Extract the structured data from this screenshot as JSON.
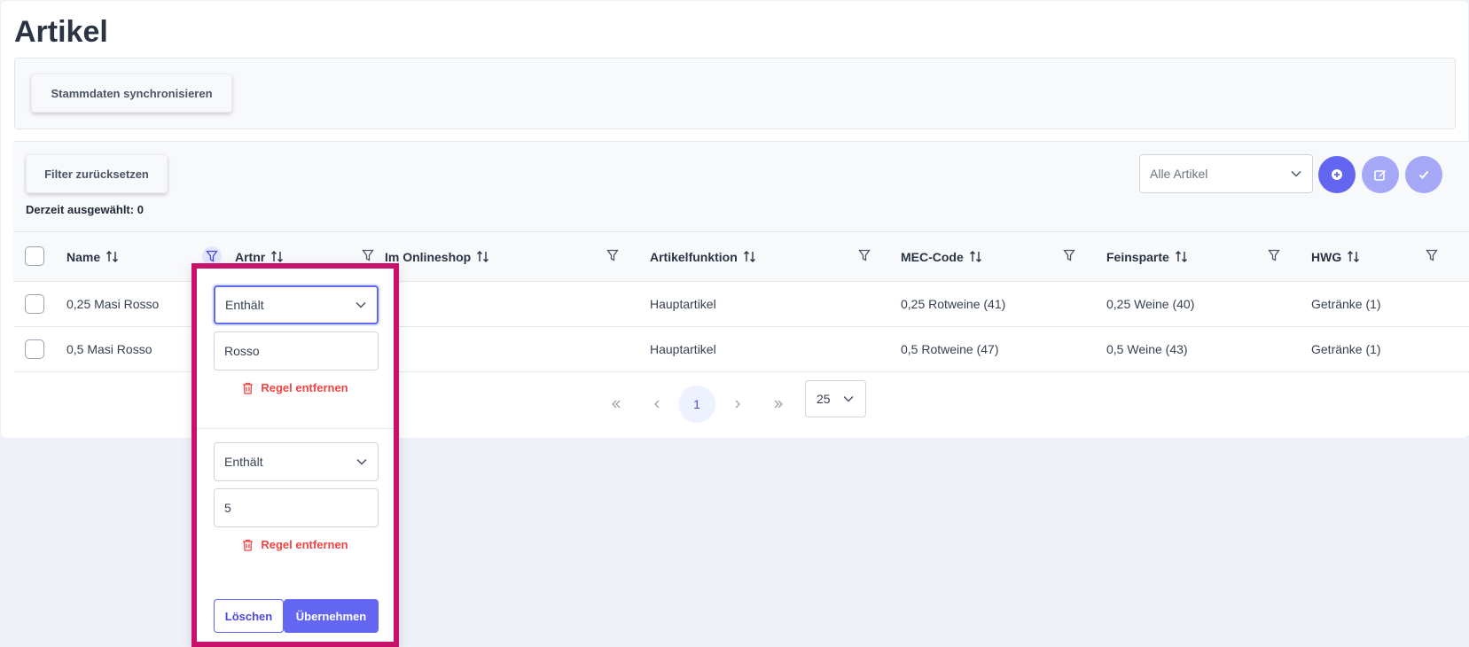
{
  "page": {
    "title": "Artikel"
  },
  "toolbar": {
    "sync_label": "Stammdaten synchronisieren",
    "reset_filter_label": "Filter zurücksetzen",
    "selected_text": "Derzeit ausgewählt: 0",
    "view_select": {
      "value": "Alle Artikel"
    }
  },
  "table": {
    "columns": [
      {
        "label": "Name"
      },
      {
        "label": "Artnr"
      },
      {
        "label": "Im Onlineshop"
      },
      {
        "label": "Artikelfunktion"
      },
      {
        "label": "MEC-Code"
      },
      {
        "label": "Feinsparte"
      },
      {
        "label": "HWG"
      }
    ],
    "rows": [
      {
        "name": "0,25 Masi Rosso",
        "artnr": "",
        "onlineshop": "",
        "funktion": "Hauptartikel",
        "mec": "0,25 Rotweine (41)",
        "feinsparte": "0,25 Weine (40)",
        "hwg": "Getränke (1)"
      },
      {
        "name": "0,5 Masi Rosso",
        "artnr": "",
        "onlineshop": "",
        "funktion": "Hauptartikel",
        "mec": "0,5 Rotweine (47)",
        "feinsparte": "0,5 Weine (43)",
        "hwg": "Getränke (1)"
      }
    ]
  },
  "pagination": {
    "current_page": "1",
    "rows_per_page": "25"
  },
  "filter_popup": {
    "rules": [
      {
        "match_mode": "Enthält",
        "value": "Rosso",
        "remove_label": "Regel entfernen"
      },
      {
        "match_mode": "Enthält",
        "value": "5",
        "remove_label": "Regel entfernen"
      }
    ],
    "clear_label": "Löschen",
    "apply_label": "Übernehmen"
  },
  "colors": {
    "accent": "#6366f1",
    "highlight_border": "#c8116a",
    "danger": "#ef4444"
  }
}
